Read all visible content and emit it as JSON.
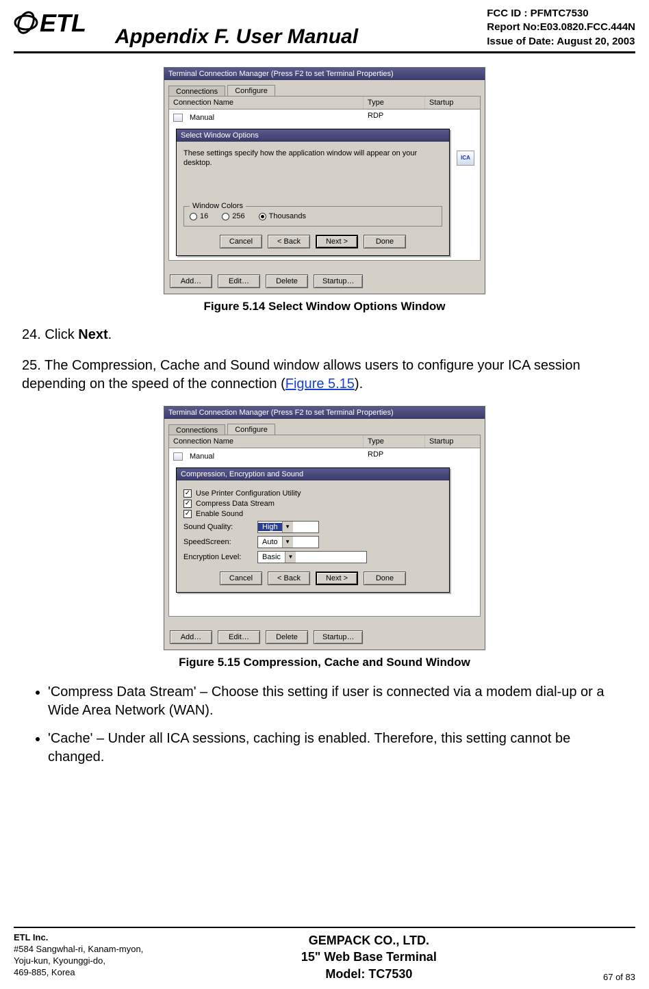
{
  "header": {
    "logo_text": "ETL",
    "title": "Appendix F. User Manual",
    "meta": {
      "fcc": "FCC ID : PFMTC7530",
      "report": "Report No:E03.0820.FCC.444N",
      "issue": "Issue of Date: August 20, 2003"
    }
  },
  "figure1": {
    "caption": "Figure 5.14   Select Window Options Window",
    "titlebar": "Terminal Connection Manager (Press F2 to set Terminal Properties)",
    "tabs": {
      "connections": "Connections",
      "configure": "Configure"
    },
    "cols": {
      "name": "Connection Name",
      "type": "Type",
      "startup": "Startup"
    },
    "row": {
      "name": "Manual",
      "type": "RDP"
    },
    "ica": "ICA",
    "dialog": {
      "titlebar": "Select Window Options",
      "msg": "These settings specify how the application window will appear on your desktop.",
      "group": "Window Colors",
      "opt16": "16",
      "opt256": "256",
      "optThousands": "Thousands",
      "cancel": "Cancel",
      "back": "< Back",
      "next": "Next >",
      "done": "Done"
    },
    "buttons": {
      "add": "Add…",
      "edit": "Edit…",
      "delete": "Delete",
      "startup": "Startup…"
    }
  },
  "steps": {
    "s24_pre": "24. Click ",
    "s24_bold": "Next",
    "s24_post": ".",
    "s25_pre": "25. The Compression, Cache and Sound window allows users to configure your ICA session depending on the speed of the connection  (",
    "s25_link": "Figure 5.15",
    "s25_post": ")."
  },
  "figure2": {
    "caption": "Figure 5.15   Compression, Cache and Sound Window",
    "titlebar": "Terminal Connection Manager (Press F2 to set Terminal Properties)",
    "tabs": {
      "connections": "Connections",
      "configure": "Configure"
    },
    "cols": {
      "name": "Connection Name",
      "type": "Type",
      "startup": "Startup"
    },
    "row": {
      "name": "Manual",
      "type": "RDP"
    },
    "dialog": {
      "titlebar": "Compression, Encryption and Sound",
      "chk1": "Use Printer Configuration Utility",
      "chk2": "Compress Data Stream",
      "chk3": "Enable Sound",
      "lblSound": "Sound Quality:",
      "valSound": "High",
      "lblSpeed": "SpeedScreen:",
      "valSpeed": "Auto",
      "lblEnc": "Encryption Level:",
      "valEnc": "Basic",
      "cancel": "Cancel",
      "back": "< Back",
      "next": "Next >",
      "done": "Done"
    },
    "buttons": {
      "add": "Add…",
      "edit": "Edit…",
      "delete": "Delete",
      "startup": "Startup…"
    }
  },
  "bullets": {
    "b1": "'Compress Data Stream' – Choose this setting if user is connected via a modem dial-up or a Wide Area Network (WAN).",
    "b2": "'Cache' – Under all ICA sessions, caching is enabled.  Therefore, this setting cannot be changed."
  },
  "footer": {
    "company": "ETL Inc.",
    "addr1": "#584 Sangwhal-ri, Kanam-myon,",
    "addr2": "Yoju-kun, Kyounggi-do,",
    "addr3": "469-885, Korea",
    "center1": "GEMPACK CO., LTD.",
    "center2": "15\" Web Base Terminal",
    "center3": "Model: TC7530",
    "page": "67 of  83"
  }
}
